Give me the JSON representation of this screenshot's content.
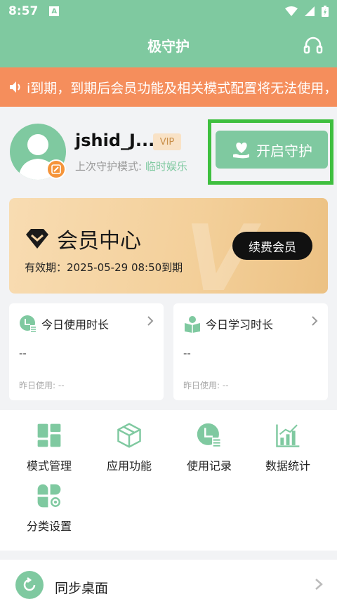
{
  "status": {
    "time": "8:57",
    "notif_letter": "A"
  },
  "app": {
    "title": "极守护"
  },
  "notice": {
    "text": "i到期，到期后会员功能及相关模式配置将无法使用，"
  },
  "profile": {
    "username": "jshid_J...",
    "vip_tag": "VIP",
    "mode_label": "上次守护模式: ",
    "mode_value": "临时娱乐"
  },
  "guard": {
    "label": "开启守护"
  },
  "member": {
    "title": "会员中心",
    "expiry": "有效期：2025-05-29 08:50到期",
    "renew_label": "续费会员",
    "watermark": "V"
  },
  "stats": [
    {
      "title": "今日使用时长",
      "value": "--",
      "yesterday": "昨日使用: --",
      "icon": "clock-list-icon"
    },
    {
      "title": "今日学习时长",
      "value": "--",
      "yesterday": "昨日使用: --",
      "icon": "reading-icon"
    }
  ],
  "grid": [
    {
      "label": "模式管理",
      "icon": "mode-grid-icon"
    },
    {
      "label": "应用功能",
      "icon": "app-box-icon"
    },
    {
      "label": "使用记录",
      "icon": "usage-record-icon"
    },
    {
      "label": "数据统计",
      "icon": "bar-chart-icon"
    },
    {
      "label": "分类设置",
      "icon": "category-settings-icon"
    }
  ],
  "sync": {
    "label": "同步桌面"
  },
  "colors": {
    "primary": "#7fc9a0",
    "notice": "#f58e5c",
    "highlight": "#3fbf3f",
    "gold": "#f3cf99"
  }
}
